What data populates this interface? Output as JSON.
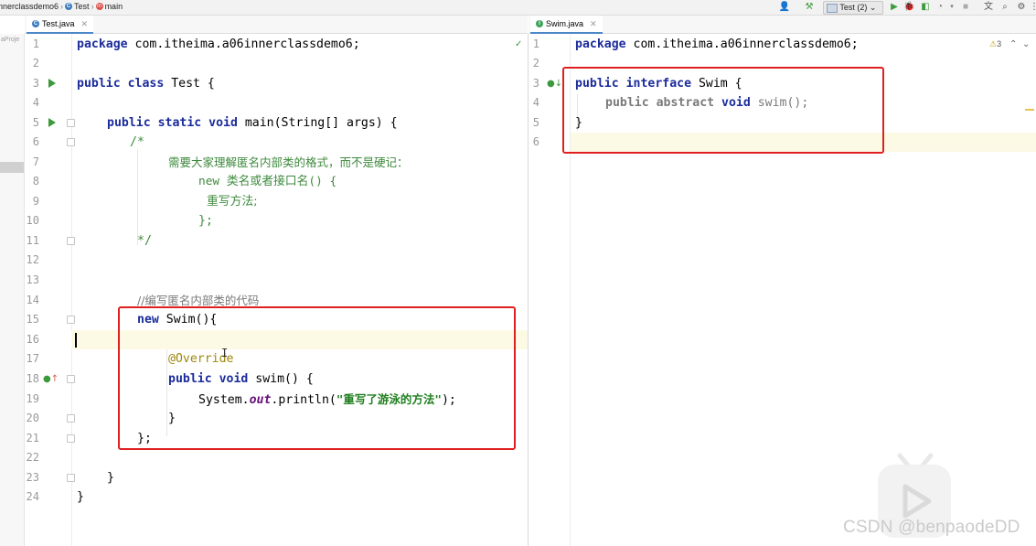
{
  "breadcrumb": {
    "project": "nnerclassdemo6",
    "file": "Test",
    "method": "main"
  },
  "toolbar": {
    "run_config": "Test (2)",
    "run_config_chevron": "⌄"
  },
  "left_tab": {
    "label": "Test.java"
  },
  "right_tab": {
    "label": "Swim.java"
  },
  "project_strip": {
    "label": "aProje"
  },
  "inspections": {
    "warnings": "3"
  },
  "left_lines": [
    {
      "n": "1"
    },
    {
      "n": "2"
    },
    {
      "n": "3"
    },
    {
      "n": "4"
    },
    {
      "n": "5"
    },
    {
      "n": "6"
    },
    {
      "n": "7"
    },
    {
      "n": "8"
    },
    {
      "n": "9"
    },
    {
      "n": "10"
    },
    {
      "n": "11"
    },
    {
      "n": "12"
    },
    {
      "n": "13"
    },
    {
      "n": "14"
    },
    {
      "n": "15"
    },
    {
      "n": "16"
    },
    {
      "n": "17"
    },
    {
      "n": "18"
    },
    {
      "n": "19"
    },
    {
      "n": "20"
    },
    {
      "n": "21"
    },
    {
      "n": "22"
    },
    {
      "n": "23"
    },
    {
      "n": "24"
    }
  ],
  "left_code": {
    "l1_kw": "package",
    "l1_rest": " com.itheima.a06innerclassdemo6;",
    "l3_kw": "public class",
    "l3_rest": " Test {",
    "l5_kw": "public static void",
    "l5_rest": " main(String[] args) {",
    "l6": "/*",
    "l7": "需要大家理解匿名内部类的格式，而不是硬记：",
    "l8": "new 类名或者接口名() {",
    "l9": "重写方法;",
    "l10": "};",
    "l11": "*/",
    "l14": "//编写匿名内部类的代码",
    "l15_kw": "new",
    "l15_rest": " Swim(){",
    "l17": "@Override",
    "l18_kw": "public void",
    "l18_rest": " swim() {",
    "l19_a": "System.",
    "l19_b": "out",
    "l19_c": ".println(",
    "l19_str": "\"重写了游泳的方法\"",
    "l19_d": ");",
    "l20": "}",
    "l21": "};",
    "l23": "}",
    "l24": "}"
  },
  "right_lines": [
    {
      "n": "1"
    },
    {
      "n": "2"
    },
    {
      "n": "3"
    },
    {
      "n": "4"
    },
    {
      "n": "5"
    },
    {
      "n": "6"
    }
  ],
  "right_code": {
    "l1_kw": "package",
    "l1_rest": " com.itheima.a06innerclassdemo6;",
    "l3_kw": "public interface",
    "l3_rest": " Swim {",
    "l4_kw": "public abstract",
    "l4_kw2": " void",
    "l4_rest": " swim();",
    "l5": "}"
  },
  "watermark": {
    "text": "CSDN @benpaodeDD"
  },
  "colors": {
    "keyword": "#1b2c9b",
    "comment_green": "#3e8a3e",
    "annotation": "#9e880d",
    "highlight_box": "#e02020",
    "caret_line": "#fcfae5"
  }
}
